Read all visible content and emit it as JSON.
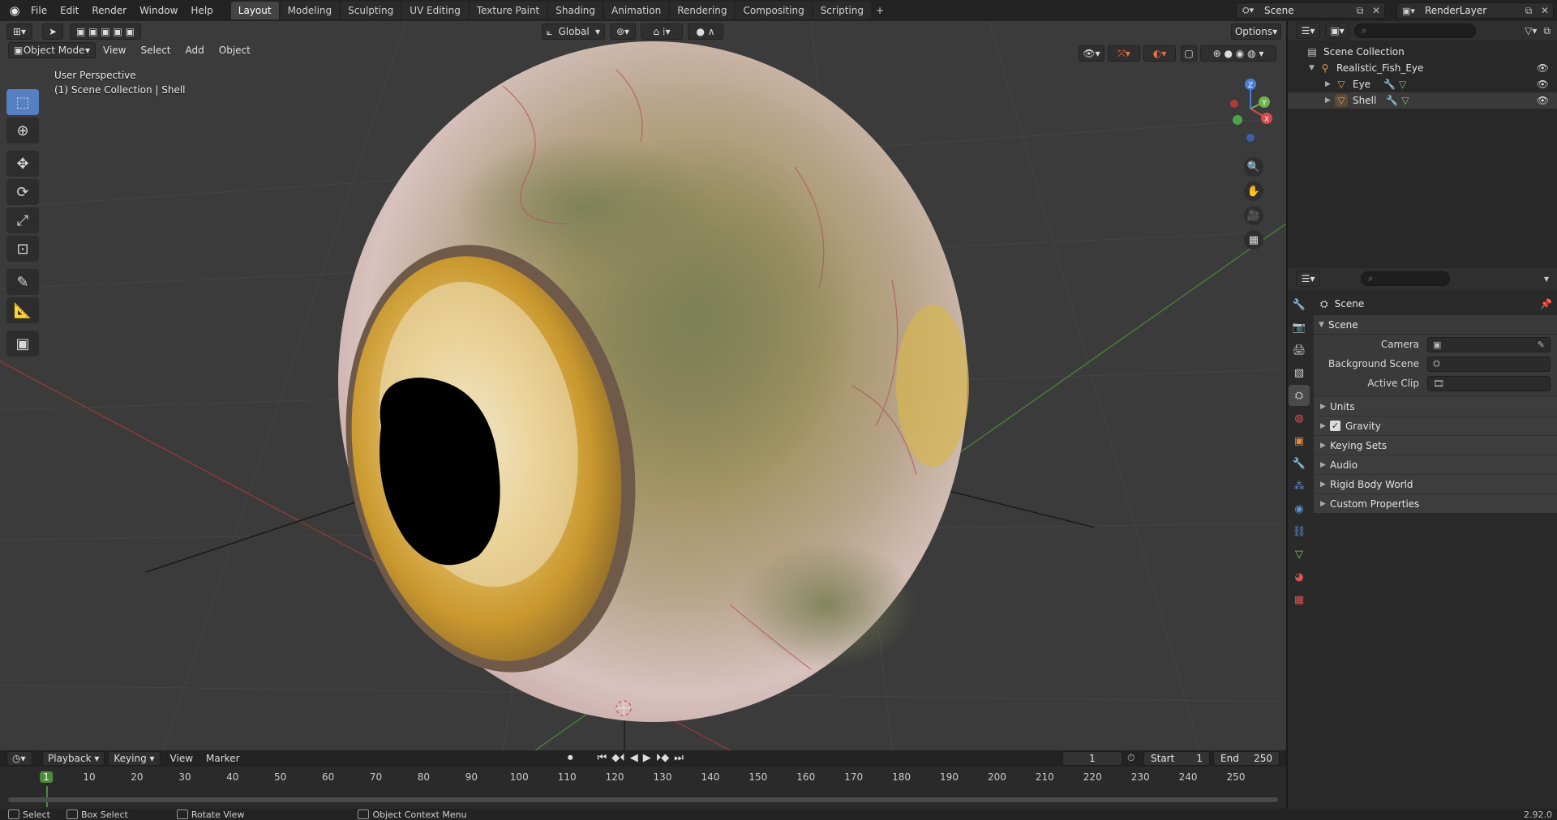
{
  "menubar": {
    "items": [
      "File",
      "Edit",
      "Render",
      "Window",
      "Help"
    ],
    "workspaces": [
      "Layout",
      "Modeling",
      "Sculpting",
      "UV Editing",
      "Texture Paint",
      "Shading",
      "Animation",
      "Rendering",
      "Compositing",
      "Scripting"
    ],
    "active_workspace": "Layout",
    "add_tab": "+",
    "scene_name": "Scene",
    "view_layer": "RenderLayer"
  },
  "viewport": {
    "mode": "Object Mode",
    "menus": [
      "View",
      "Select",
      "Add",
      "Object"
    ],
    "transform_orientation": "Global",
    "options_label": "Options",
    "info_line1": "User Perspective",
    "info_line2": "(1) Scene Collection | Shell",
    "tools": [
      "select-box",
      "cursor",
      "move",
      "rotate",
      "scale",
      "transform",
      "annotate",
      "measure",
      "add-cube"
    ],
    "gizmo_axes": {
      "x": "X",
      "y": "Y",
      "z": "Z"
    },
    "colors": {
      "x_axis": "#d94a4a",
      "y_axis": "#6fb34a",
      "z_axis": "#4a7fd9",
      "active_tool": "#5680c2"
    }
  },
  "timeline": {
    "menus": [
      "Playback",
      "Keying",
      "View",
      "Marker"
    ],
    "current_frame": "1",
    "start_label": "Start",
    "start": "1",
    "end_label": "End",
    "end": "250",
    "ruler": [
      "1",
      "10",
      "20",
      "30",
      "40",
      "50",
      "60",
      "70",
      "80",
      "90",
      "100",
      "110",
      "120",
      "130",
      "140",
      "150",
      "160",
      "170",
      "180",
      "190",
      "200",
      "210",
      "220",
      "230",
      "240",
      "250"
    ]
  },
  "statusbar": {
    "select": "Select",
    "box_select": "Box Select",
    "rotate_view": "Rotate View",
    "context_menu": "Object Context Menu",
    "version": "2.92.0"
  },
  "outliner": {
    "collection": "Scene Collection",
    "items": [
      {
        "name": "Realistic_Fish_Eye",
        "level": 1
      },
      {
        "name": "Eye",
        "level": 2
      },
      {
        "name": "Shell",
        "level": 2
      }
    ]
  },
  "properties": {
    "context": "Scene",
    "panel": "Scene",
    "fields": {
      "camera": "Camera",
      "background_scene": "Background Scene",
      "active_clip": "Active Clip"
    },
    "subpanels": [
      "Units",
      "Gravity",
      "Keying Sets",
      "Audio",
      "Rigid Body World",
      "Custom Properties"
    ],
    "gravity_checked": true
  }
}
